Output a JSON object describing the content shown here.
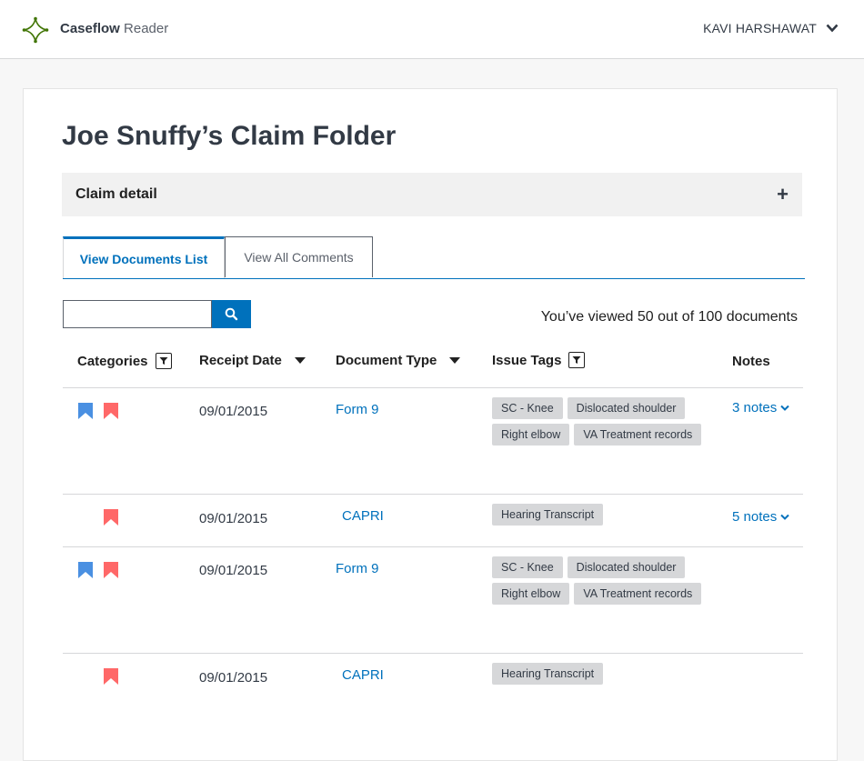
{
  "header": {
    "brand_bold": "Caseflow",
    "brand_sub": "Reader",
    "user_name": "KAVI HARSHAWAT"
  },
  "page": {
    "title": "Joe Snuffy’s Claim Folder",
    "claim_detail_label": "Claim detail",
    "claim_detail_toggle": "+"
  },
  "tabs": [
    {
      "label": "View Documents List",
      "active": true
    },
    {
      "label": "View All Comments",
      "active": false
    }
  ],
  "search": {
    "value": "",
    "placeholder": ""
  },
  "viewed_text": "You’ve viewed 50 out of 100 documents",
  "table": {
    "headers": {
      "categories": "Categories",
      "receipt_date": "Receipt Date",
      "document_type": "Document Type",
      "issue_tags": "Issue Tags",
      "notes": "Notes"
    },
    "rows": [
      {
        "categories": [
          "procedural",
          "medical"
        ],
        "date": "09/01/2015",
        "doc_type": "Form 9",
        "tags": [
          "SC - Knee",
          "Dislocated shoulder",
          "Right elbow",
          "VA Treatment records"
        ],
        "notes": "3 notes"
      },
      {
        "categories": [
          "medical"
        ],
        "date": "09/01/2015",
        "doc_type": "CAPRI",
        "tags": [
          "Hearing Transcript"
        ],
        "notes": "5 notes"
      },
      {
        "categories": [
          "procedural",
          "medical"
        ],
        "date": "09/01/2015",
        "doc_type": "Form 9",
        "tags": [
          "SC - Knee",
          "Dislocated shoulder",
          "Right elbow",
          "VA Treatment records"
        ],
        "notes": ""
      },
      {
        "categories": [
          "medical"
        ],
        "date": "09/01/2015",
        "doc_type": "CAPRI",
        "tags": [
          "Hearing Transcript"
        ],
        "notes": ""
      }
    ]
  },
  "colors": {
    "primary": "#0071bc",
    "bookmark_blue": "#4a90e2",
    "bookmark_red": "#ff6868",
    "logo_green": "#417505"
  }
}
